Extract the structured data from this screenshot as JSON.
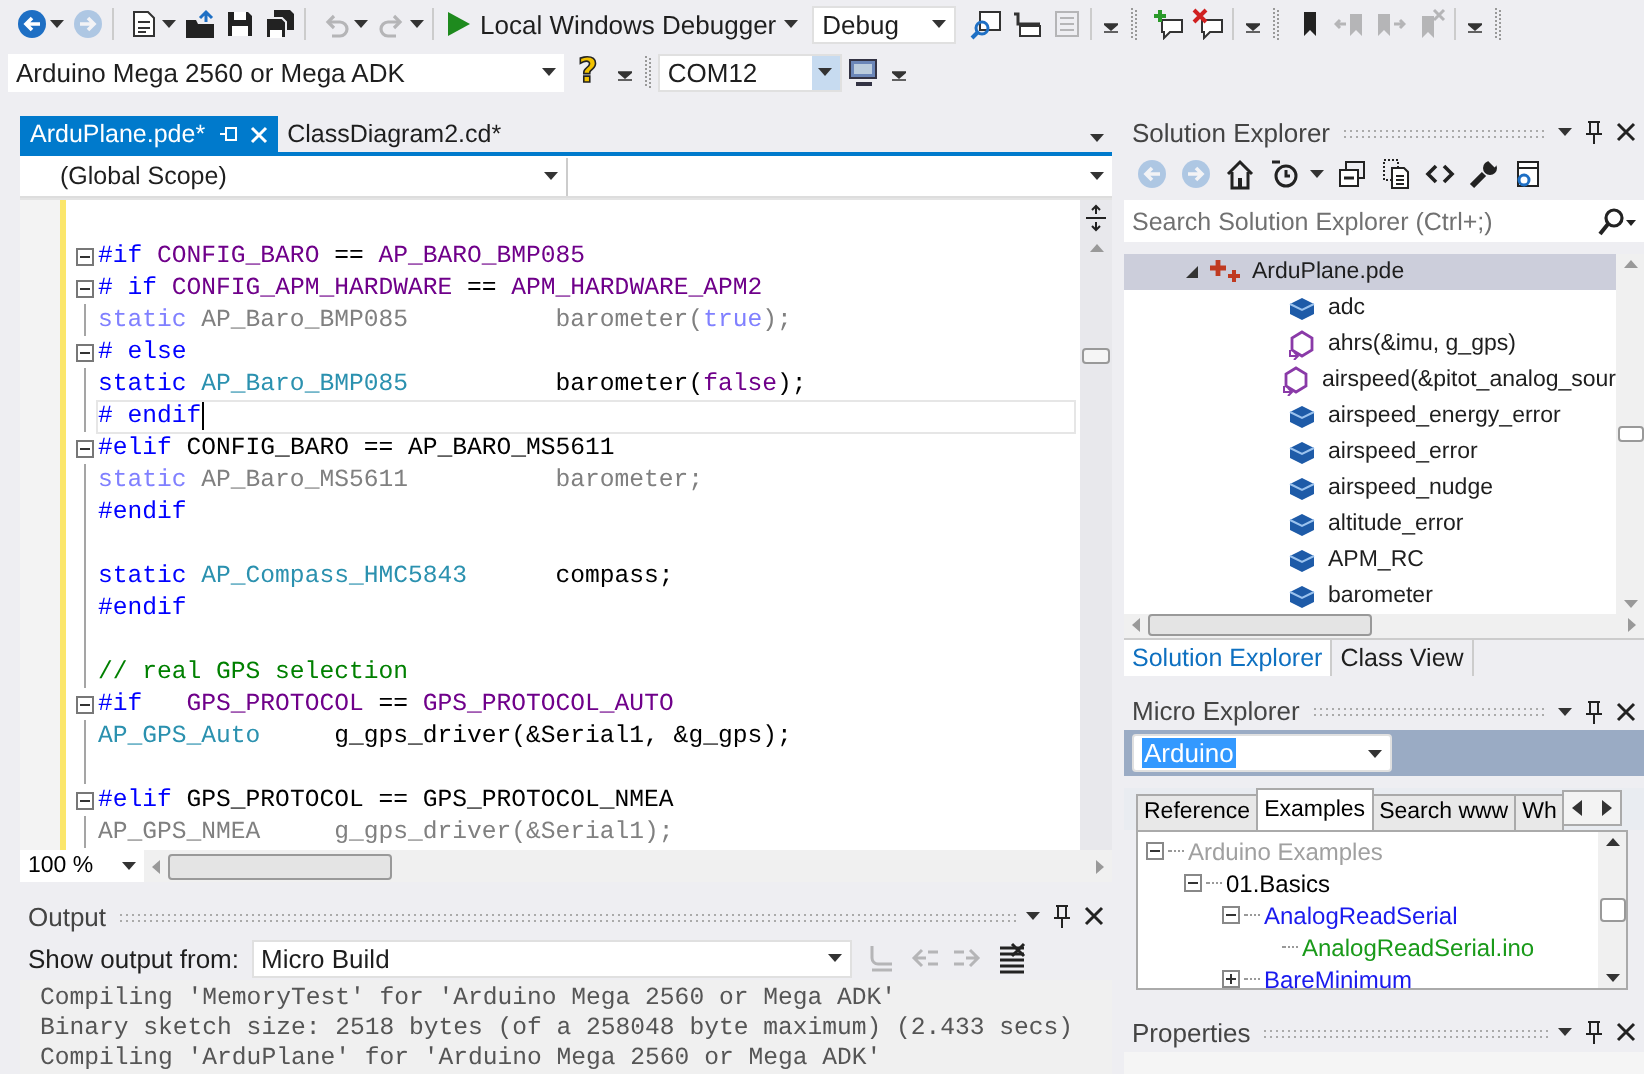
{
  "toolbar": {
    "groups": [
      [
        {
          "kind": "back",
          "disabled": false,
          "menu": true
        },
        {
          "kind": "forward",
          "disabled": true,
          "menu": false
        }
      ],
      [
        {
          "kind": "new-project",
          "disabled": false,
          "menu": true
        },
        {
          "kind": "open",
          "disabled": false,
          "menu": false
        },
        {
          "kind": "save",
          "disabled": false,
          "menu": false
        },
        {
          "kind": "save-all",
          "disabled": false,
          "menu": false
        }
      ],
      [
        {
          "kind": "undo",
          "disabled": true,
          "menu": true
        },
        {
          "kind": "redo",
          "disabled": true,
          "menu": true
        }
      ]
    ],
    "start_button": {
      "label": "Local Windows Debugger"
    },
    "configuration": {
      "value": "Debug"
    },
    "tools": [
      [
        {
          "kind": "attach",
          "disabled": false,
          "menu": false
        },
        {
          "kind": "indent",
          "disabled": false,
          "menu": false
        },
        {
          "kind": "outdent",
          "disabled": true,
          "menu": false
        }
      ],
      [
        {
          "kind": "add-comment",
          "disabled": false,
          "menu": false
        },
        {
          "kind": "remove-comment",
          "disabled": false,
          "menu": false
        }
      ],
      [
        {
          "kind": "bookmark",
          "disabled": false,
          "menu": false
        },
        {
          "kind": "prev-bookmark",
          "disabled": true,
          "menu": false
        },
        {
          "kind": "next-bookmark",
          "disabled": true,
          "menu": false
        },
        {
          "kind": "clear-bookmark",
          "disabled": true,
          "menu": false
        }
      ]
    ]
  },
  "board_bar": {
    "board": "Arduino Mega 2560 or Mega ADK",
    "help": "?",
    "port": "COM12"
  },
  "editor": {
    "tabs": [
      {
        "label": "ArduPlane.pde*",
        "selected": true
      },
      {
        "label": "ClassDiagram2.cd*",
        "selected": false
      }
    ],
    "scope": "(Global Scope)",
    "zoom": "100 %",
    "lines": [
      {
        "fold": false,
        "current": false
      },
      {
        "fold": true,
        "current": false,
        "segments": [
          {
            "kind": "kw",
            "text": "#if"
          },
          {
            "kind": "macro",
            "text": " CONFIG_BARO"
          },
          {
            "kind": "plain",
            "text": " == "
          },
          {
            "kind": "macro",
            "text": "AP_BARO_BMP085"
          }
        ]
      },
      {
        "fold": true,
        "current": false,
        "segments": [
          {
            "kind": "kw",
            "text": "# if"
          },
          {
            "kind": "macro",
            "text": " CONFIG_APM_HARDWARE"
          },
          {
            "kind": "plain",
            "text": " == "
          },
          {
            "kind": "macro",
            "text": "APM_HARDWARE_APM2"
          }
        ]
      },
      {
        "fold": false,
        "current": false,
        "segments": [
          {
            "kind": "dimkw",
            "text": "static"
          },
          {
            "kind": "dim",
            "text": " AP_Baro_BMP085          barometer("
          },
          {
            "kind": "dimkw",
            "text": "true"
          },
          {
            "kind": "dim",
            "text": ");"
          }
        ]
      },
      {
        "fold": true,
        "current": false,
        "segments": [
          {
            "kind": "kw",
            "text": "# else"
          }
        ]
      },
      {
        "fold": false,
        "current": false,
        "segments": [
          {
            "kind": "kw",
            "text": "static"
          },
          {
            "kind": "type",
            "text": " AP_Baro_BMP085"
          },
          {
            "kind": "plain",
            "text": "          barometer("
          },
          {
            "kind": "macro",
            "text": "false"
          },
          {
            "kind": "plain",
            "text": ");"
          }
        ]
      },
      {
        "fold": false,
        "current": true,
        "segments": [
          {
            "kind": "kw",
            "text": "# endif"
          }
        ]
      },
      {
        "fold": true,
        "current": false,
        "segments": [
          {
            "kind": "kw",
            "text": "#elif"
          },
          {
            "kind": "plain",
            "text": " CONFIG_BARO == AP_BARO_MS5611"
          }
        ]
      },
      {
        "fold": false,
        "current": false,
        "segments": [
          {
            "kind": "dimkw",
            "text": "static"
          },
          {
            "kind": "dim",
            "text": " AP_Baro_MS5611          barometer;"
          }
        ]
      },
      {
        "fold": false,
        "current": false,
        "segments": [
          {
            "kind": "kw",
            "text": "#endif"
          }
        ]
      },
      {
        "fold": false,
        "current": false
      },
      {
        "fold": false,
        "current": false,
        "segments": [
          {
            "kind": "kw",
            "text": "static"
          },
          {
            "kind": "type",
            "text": " AP_Compass_HMC5843"
          },
          {
            "kind": "plain",
            "text": "      compass;"
          }
        ]
      },
      {
        "fold": false,
        "current": false,
        "segments": [
          {
            "kind": "kw",
            "text": "#endif"
          }
        ]
      },
      {
        "fold": false,
        "current": false
      },
      {
        "fold": false,
        "current": false,
        "segments": [
          {
            "kind": "comment",
            "text": "// real GPS selection"
          }
        ]
      },
      {
        "fold": true,
        "current": false,
        "segments": [
          {
            "kind": "kw",
            "text": "#if"
          },
          {
            "kind": "macro",
            "text": "   GPS_PROTOCOL"
          },
          {
            "kind": "plain",
            "text": " == "
          },
          {
            "kind": "macro",
            "text": "GPS_PROTOCOL_AUTO"
          }
        ]
      },
      {
        "fold": false,
        "current": false,
        "segments": [
          {
            "kind": "type",
            "text": "AP_GPS_Auto"
          },
          {
            "kind": "plain",
            "text": "     g_gps_driver(&Serial1, &g_gps);"
          }
        ]
      },
      {
        "fold": false,
        "current": false
      },
      {
        "fold": true,
        "current": false,
        "segments": [
          {
            "kind": "kw",
            "text": "#elif"
          },
          {
            "kind": "plain",
            "text": " GPS_PROTOCOL == GPS_PROTOCOL_NMEA"
          }
        ]
      },
      {
        "fold": false,
        "current": false,
        "segments": [
          {
            "kind": "dim",
            "text": "AP_GPS_NMEA     g_gps_driver(&Serial1);"
          }
        ]
      }
    ]
  },
  "output": {
    "title": "Output",
    "source_label": "Show output from:",
    "source": "Micro Build",
    "tools": [
      {
        "kind": "goto",
        "disabled": true
      },
      {
        "kind": "prev",
        "disabled": true
      },
      {
        "kind": "next",
        "disabled": true
      },
      {
        "kind": "clear",
        "disabled": false
      }
    ],
    "lines": [
      "Compiling 'MemoryTest' for 'Arduino Mega 2560 or Mega ADK'",
      "Binary sketch size: 2518 bytes (of a 258048 byte maximum) (2.433 secs)",
      "Compiling 'ArduPlane' for 'Arduino Mega 2560 or Mega ADK'"
    ]
  },
  "solution_explorer": {
    "title": "Solution Explorer",
    "tools": [
      {
        "kind": "back",
        "disabled": true
      },
      {
        "kind": "forward",
        "disabled": true
      },
      {
        "kind": "home",
        "disabled": false
      },
      {
        "kind": "history",
        "disabled": false
      },
      {
        "kind": "collapse",
        "disabled": false
      },
      {
        "kind": "show-all",
        "disabled": false
      },
      {
        "kind": "code",
        "disabled": false
      },
      {
        "kind": "wrench",
        "disabled": false
      },
      {
        "kind": "preview",
        "disabled": false
      }
    ],
    "search": {
      "placeholder": "Search Solution Explorer (Ctrl+;)"
    },
    "tree": [
      {
        "label": "ArduPlane.pde",
        "kind": "source",
        "expanded": true,
        "selected": true,
        "children": [
          {
            "label": "adc",
            "kind": "field",
            "selected": false
          },
          {
            "label": "ahrs(&imu, g_gps)",
            "kind": "method",
            "selected": false
          },
          {
            "label": "airspeed(&pitot_analog_sour",
            "kind": "method",
            "selected": false
          },
          {
            "label": "airspeed_energy_error",
            "kind": "field",
            "selected": false
          },
          {
            "label": "airspeed_error",
            "kind": "field",
            "selected": false
          },
          {
            "label": "airspeed_nudge",
            "kind": "field",
            "selected": false
          },
          {
            "label": "altitude_error",
            "kind": "field",
            "selected": false
          },
          {
            "label": "APM_RC",
            "kind": "field",
            "selected": false
          },
          {
            "label": "barometer",
            "kind": "field",
            "selected": false
          }
        ]
      }
    ],
    "tabs": [
      {
        "label": "Solution Explorer",
        "selected": true
      },
      {
        "label": "Class View",
        "selected": false
      }
    ]
  },
  "micro_explorer": {
    "title": "Micro Explorer",
    "platform": "Arduino",
    "tabs": [
      {
        "label": "Reference",
        "selected": false
      },
      {
        "label": "Examples",
        "selected": true
      },
      {
        "label": "Search www",
        "selected": false
      },
      {
        "label": "Wh",
        "selected": false
      }
    ],
    "tree": [
      {
        "label": "Arduino Examples",
        "kind": "root",
        "expanded": true,
        "children": [
          {
            "label": "01.Basics",
            "kind": "folder",
            "expanded": true,
            "children": [
              {
                "label": "AnalogReadSerial",
                "kind": "sketch",
                "expanded": true,
                "children": [
                  {
                    "label": "AnalogReadSerial.ino",
                    "kind": "file"
                  }
                ]
              },
              {
                "label": "BareMinimum",
                "kind": "sketch",
                "expanded": false
              }
            ]
          }
        ]
      }
    ]
  },
  "properties": {
    "title": "Properties"
  }
}
